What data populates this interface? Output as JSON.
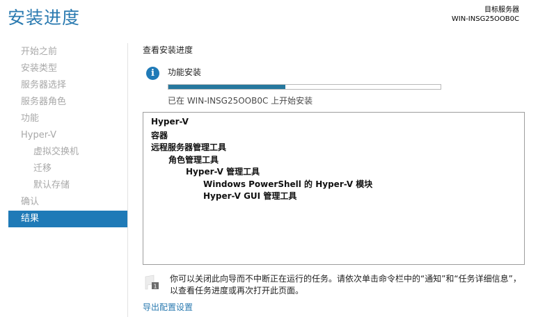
{
  "header": {
    "title": "安装进度",
    "target_server_label": "目标服务器",
    "target_server_name": "WIN-INSG25OOB0C"
  },
  "nav": {
    "items": [
      {
        "label": "开始之前",
        "sub": false,
        "active": false
      },
      {
        "label": "安装类型",
        "sub": false,
        "active": false
      },
      {
        "label": "服务器选择",
        "sub": false,
        "active": false
      },
      {
        "label": "服务器角色",
        "sub": false,
        "active": false
      },
      {
        "label": "功能",
        "sub": false,
        "active": false
      },
      {
        "label": "Hyper-V",
        "sub": false,
        "active": false
      },
      {
        "label": "虚拟交换机",
        "sub": true,
        "active": false
      },
      {
        "label": "迁移",
        "sub": true,
        "active": false
      },
      {
        "label": "默认存储",
        "sub": true,
        "active": false
      },
      {
        "label": "确认",
        "sub": false,
        "active": false
      },
      {
        "label": "结果",
        "sub": false,
        "active": true
      }
    ]
  },
  "main": {
    "section_title": "查看安装进度",
    "info_icon": "info-icon",
    "feature_install_label": "功能安装",
    "progress_fraction": 0.43,
    "progress_status": "已在 WIN-INSG25OOB0C 上开始安装",
    "features": [
      {
        "label": "Hyper-V",
        "level": 0
      },
      {
        "label": "容器",
        "level": 0
      },
      {
        "label": "远程服务器管理工具",
        "level": 0
      },
      {
        "label": "角色管理工具",
        "level": 1
      },
      {
        "label": "Hyper-V 管理工具",
        "level": 2
      },
      {
        "label": "Windows PowerShell 的 Hyper-V 模块",
        "level": 3
      },
      {
        "label": "Hyper-V GUI 管理工具",
        "level": 3
      }
    ],
    "note_icon": "flag-notification-icon",
    "note_text": "你可以关闭此向导而不中断正在运行的任务。请依次单击命令栏中的“通知”和“任务详细信息”，以查看任务进度或再次打开此页面。",
    "export_link": "导出配置设置"
  },
  "colors": {
    "accent": "#1f7ab7",
    "title": "#2a7ab0",
    "progress_fill": "#26789e"
  }
}
